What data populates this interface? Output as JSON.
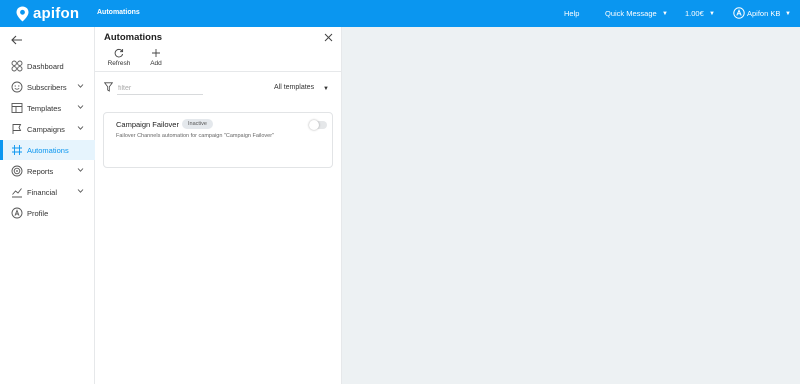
{
  "brand": {
    "name": "apifon",
    "color": "#0a96f0"
  },
  "topbar": {
    "section_title": "Automations",
    "help": "Help",
    "quick_message": "Quick Message",
    "balance": "1.00€",
    "user": "Apifon KB"
  },
  "sidebar": {
    "items": [
      {
        "label": "Dashboard",
        "icon": "grid-icon",
        "has_chevron": false
      },
      {
        "label": "Subscribers",
        "icon": "smiley-icon",
        "has_chevron": true
      },
      {
        "label": "Templates",
        "icon": "templates-icon",
        "has_chevron": true
      },
      {
        "label": "Campaigns",
        "icon": "flag-icon",
        "has_chevron": true
      },
      {
        "label": "Automations",
        "icon": "automations-icon",
        "has_chevron": false,
        "active": true
      },
      {
        "label": "Reports",
        "icon": "target-icon",
        "has_chevron": true
      },
      {
        "label": "Financial",
        "icon": "chart-icon",
        "has_chevron": true
      },
      {
        "label": "Profile",
        "icon": "profile-icon",
        "has_chevron": false
      }
    ]
  },
  "panel": {
    "title": "Automations",
    "refresh_label": "Refresh",
    "add_label": "Add",
    "filter_placeholder": "filter",
    "filter_value": "",
    "template_filter": "All templates"
  },
  "automations": [
    {
      "name": "Campaign Failover",
      "status": "Inactive",
      "description": "Failover Channels automation for campaign \"Campaign Failover\"",
      "enabled": false
    }
  ]
}
